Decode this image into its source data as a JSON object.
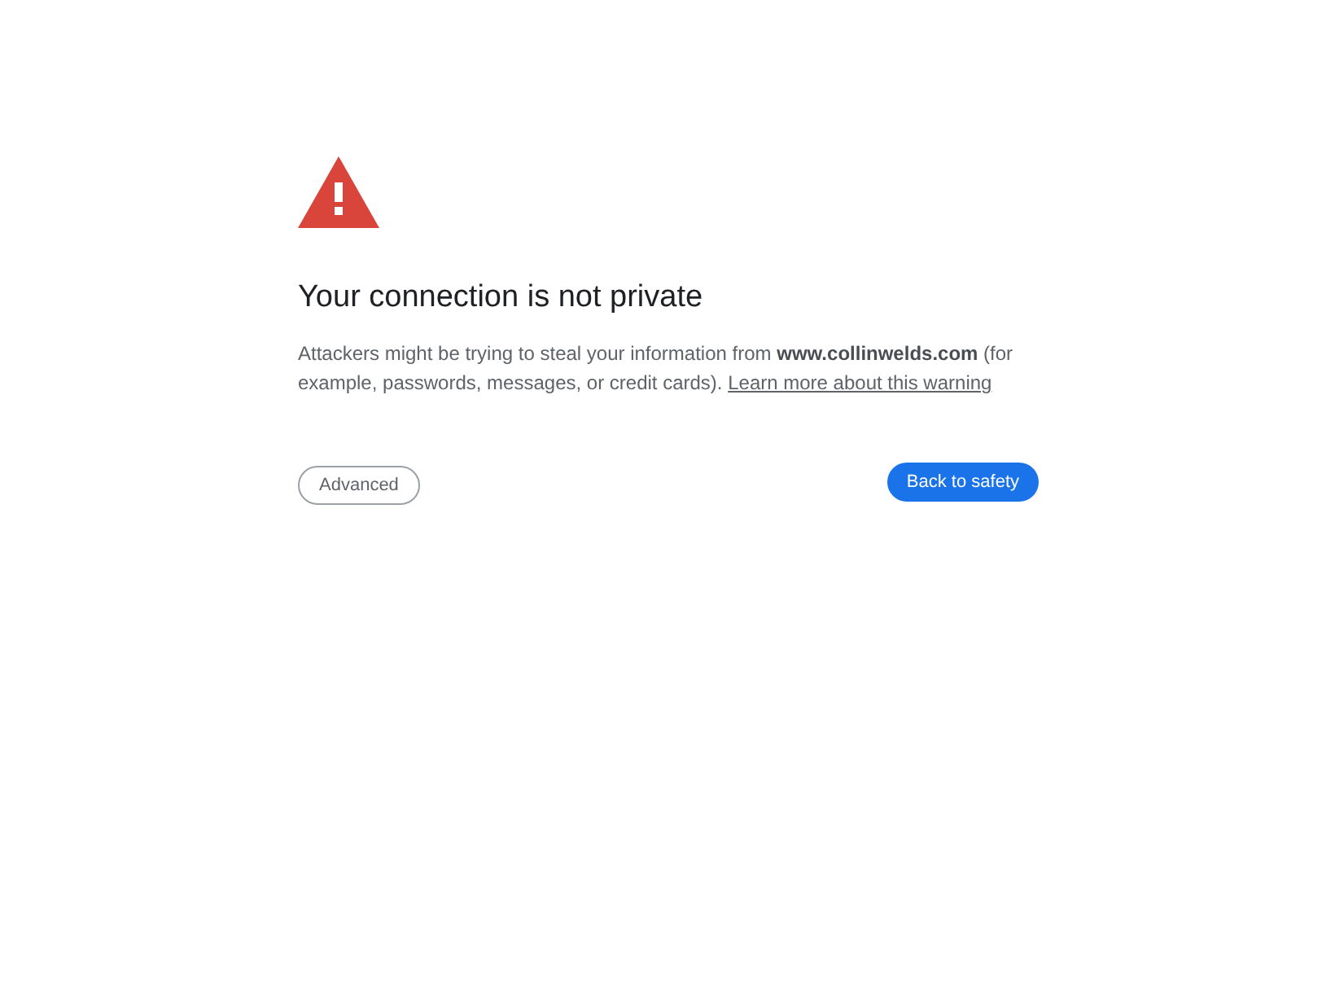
{
  "heading": "Your connection is not private",
  "message": "Attackers might be trying to steal your information from **www.collinwelds.com** (for example, passwords, messages, or credit cards).",
  "learn_more_link": "Learn more about this warning",
  "buttons": [
    {
      "label": "Advanced",
      "kind": "secondary"
    },
    {
      "label": "Back to safety",
      "kind": "primary"
    }
  ]
}
